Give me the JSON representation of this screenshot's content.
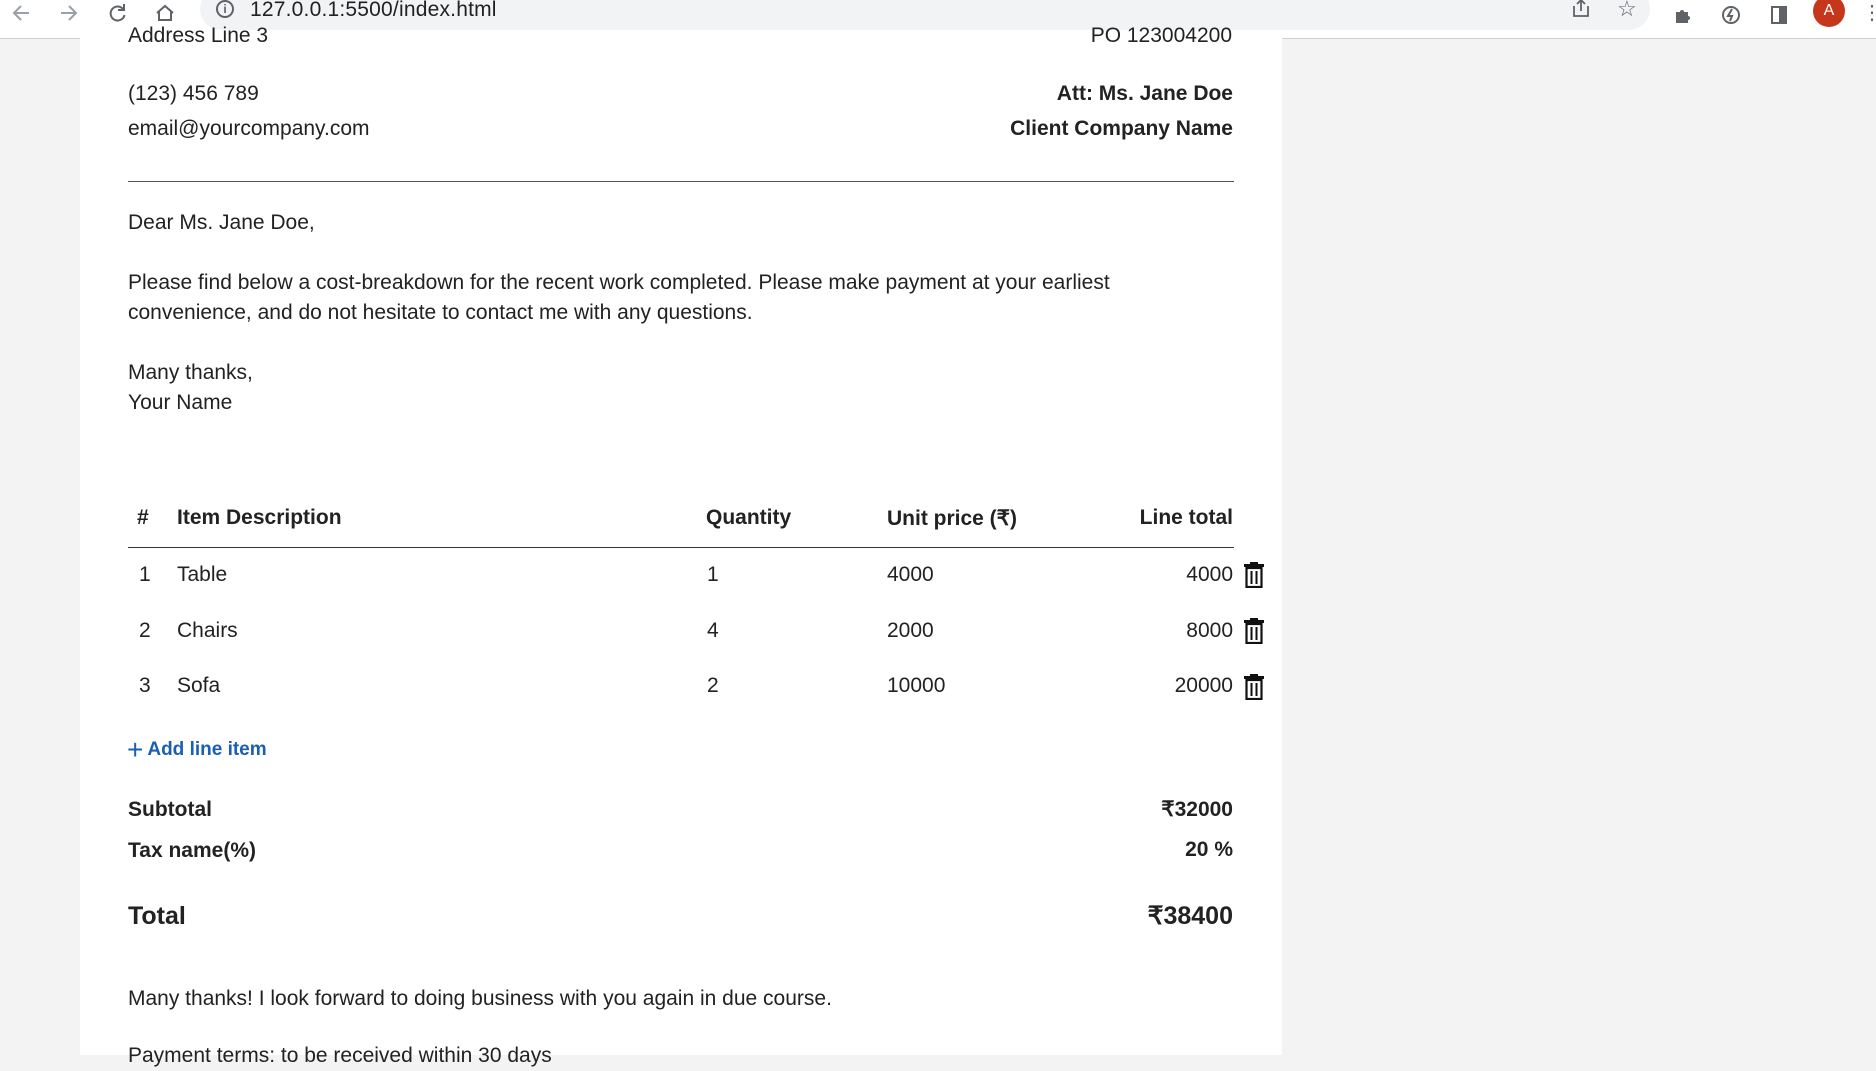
{
  "browser": {
    "url": "127.0.0.1:5500/index.html",
    "back_icon": "back-arrow-icon",
    "forward_icon": "forward-arrow-icon",
    "reload_icon": "reload-icon",
    "home_icon": "home-icon",
    "avatar_letter": "A",
    "avatar_color": "#c5361b"
  },
  "header": {
    "cut_left": "Address Line 3",
    "cut_right": "PO 123004200",
    "phone": "(123) 456 789",
    "email": "email@yourcompany.com",
    "attention": "Att: Ms. Jane Doe",
    "client_company": "Client Company Name"
  },
  "letter": {
    "greeting": "Dear Ms. Jane Doe,",
    "body_line1": "Please find below a cost-breakdown for the recent work completed. Please make payment at your earliest",
    "body_line2": "convenience, and do not hesitate to contact me with any questions.",
    "closing": "Many thanks,",
    "signature": "Your Name"
  },
  "table": {
    "headers": {
      "number": "#",
      "description": "Item Description",
      "quantity": "Quantity",
      "unit_price": "Unit price (₹)",
      "line_total": "Line total"
    },
    "rows": [
      {
        "number": "1",
        "description": "Table",
        "quantity": "1",
        "unit_price": "4000",
        "line_total": "4000"
      },
      {
        "number": "2",
        "description": "Chairs",
        "quantity": "4",
        "unit_price": "2000",
        "line_total": "8000"
      },
      {
        "number": "3",
        "description": "Sofa",
        "quantity": "2",
        "unit_price": "10000",
        "line_total": "20000"
      }
    ],
    "add_item_label": "Add line item"
  },
  "summary": {
    "subtotal_label": "Subtotal",
    "subtotal_value": "₹32000",
    "tax_label": "Tax name(%)",
    "tax_value": "20 %",
    "total_label": "Total",
    "total_value": "₹38400"
  },
  "footer": {
    "thanks": "Many thanks! I look forward to doing business with you again in due course.",
    "cut_bottom": "Payment terms: to be received within 30 days"
  },
  "colors": {
    "link": "#1a5fb4",
    "page_bg": "#f3f3f3",
    "paper": "#ffffff"
  }
}
